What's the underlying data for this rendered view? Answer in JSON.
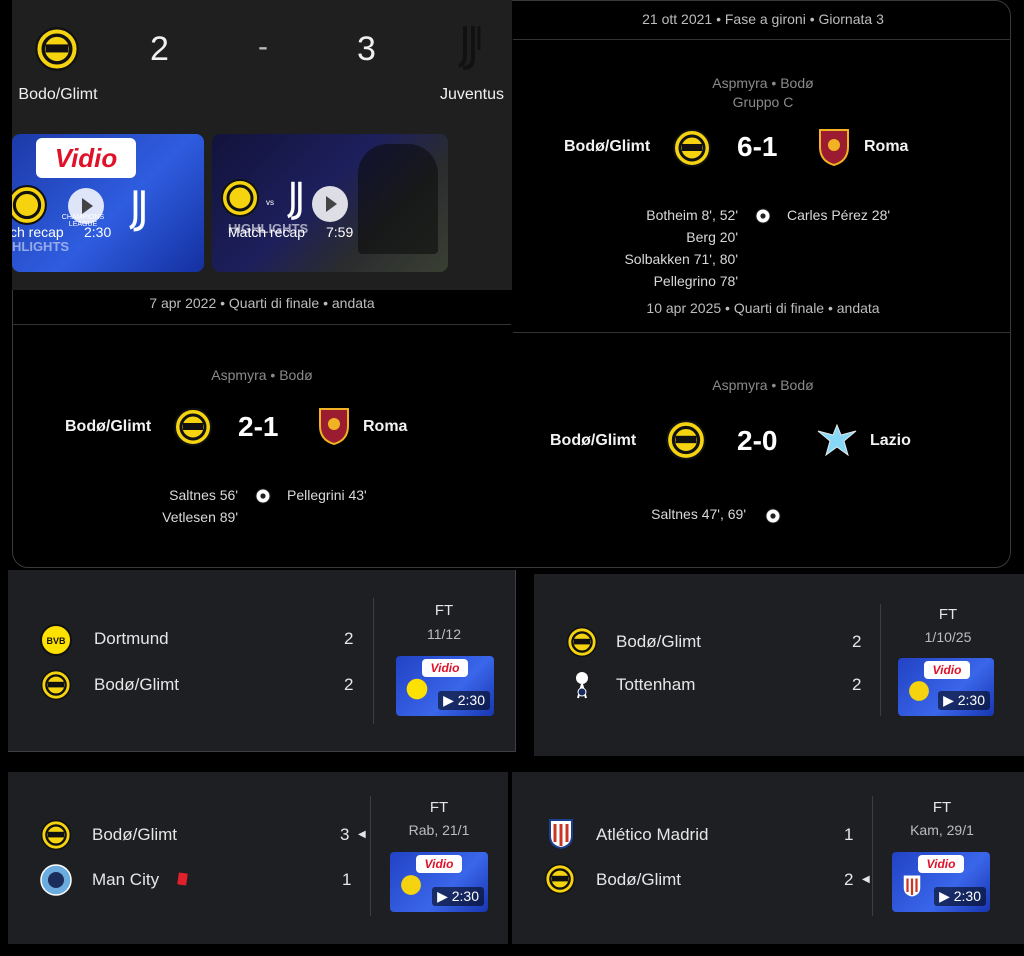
{
  "top_match": {
    "home_team": "Bodo/Glimt",
    "away_team": "Juventus",
    "home_score": "2",
    "separator": "-",
    "away_score": "3",
    "videos": [
      {
        "brand": "Vidio",
        "competition": "CHAMPIONS LEAGUE",
        "caption": "ch recap",
        "duration": "2:30",
        "tag": "HLIGHTS"
      },
      {
        "caption": "Match recap",
        "duration": "7:59",
        "tag": "HIGHLIGHTS",
        "vs": "vs"
      }
    ]
  },
  "matches": [
    {
      "meta": "21 ott 2021 • Fase a gironi • Giornata 3",
      "venue": "Aspmyra • Bodø",
      "group": "Gruppo C",
      "home": "Bodø/Glimt",
      "score": "6-1",
      "away": "Roma",
      "home_scorers": [
        "Botheim 8', 52'",
        "Berg 20'",
        "Solbakken 71', 80'",
        "Pellegrino 78'"
      ],
      "away_scorers": [
        "Carles Pérez 28'"
      ]
    },
    {
      "meta": "7 apr 2022 • Quarti di finale • andata",
      "venue": "Aspmyra • Bodø",
      "home": "Bodø/Glimt",
      "score": "2-1",
      "away": "Roma",
      "home_scorers": [
        "Saltnes 56'",
        "Vetlesen 89'"
      ],
      "away_scorers": [
        "Pellegrini 43'"
      ]
    },
    {
      "meta": "10 apr 2025 • Quarti di finale • andata",
      "venue": "Aspmyra • Bodø",
      "home": "Bodø/Glimt",
      "score": "2-0",
      "away": "Lazio",
      "home_scorers": [
        "Saltnes 47', 69'"
      ],
      "away_scorers": []
    }
  ],
  "fixtures": [
    {
      "home": "Dortmund",
      "away": "Bodø/Glimt",
      "home_score": "2",
      "away_score": "2",
      "status": "FT",
      "date": "11/12",
      "brand": "Vidio",
      "duration": "2:30"
    },
    {
      "home": "Bodø/Glimt",
      "away": "Tottenham",
      "home_score": "2",
      "away_score": "2",
      "status": "FT",
      "date": "1/10/25",
      "brand": "Vidio",
      "duration": "2:30"
    },
    {
      "home": "Bodø/Glimt",
      "away": "Man City",
      "home_score": "3",
      "away_score": "1",
      "status": "FT",
      "date": "Rab, 21/1",
      "brand": "Vidio",
      "duration": "2:30",
      "winner": "home",
      "red_card": "away"
    },
    {
      "home": "Atlético Madrid",
      "away": "Bodø/Glimt",
      "home_score": "1",
      "away_score": "2",
      "status": "FT",
      "date": "Kam, 29/1",
      "brand": "Vidio",
      "duration": "2:30",
      "winner": "away"
    }
  ],
  "colors": {
    "bodo_yellow": "#f5d40f",
    "roma_red": "#9b1b30",
    "vidio_red": "#e0122a",
    "dortmund_yellow": "#fde100",
    "atletico_red": "#cb3524",
    "city_blue": "#6cabdd",
    "lazio_blue": "#87d8f7"
  }
}
